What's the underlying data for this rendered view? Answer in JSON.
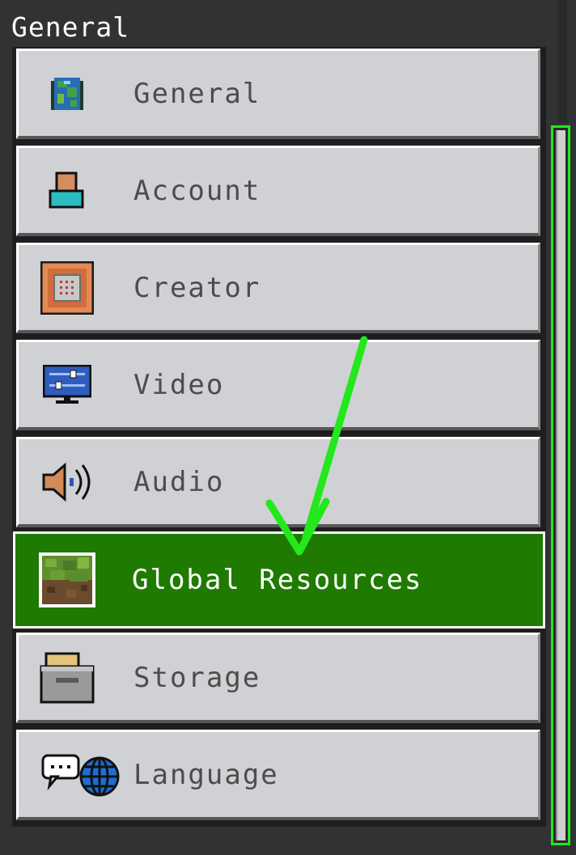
{
  "section": {
    "title": "General"
  },
  "menu": {
    "items": [
      {
        "label": "General"
      },
      {
        "label": "Account"
      },
      {
        "label": "Creator"
      },
      {
        "label": "Video"
      },
      {
        "label": "Audio"
      },
      {
        "label": "Global Resources",
        "selected": true
      },
      {
        "label": "Storage"
      },
      {
        "label": "Language"
      }
    ]
  },
  "colors": {
    "background": "#313233",
    "item_bg": "#d0d1d4",
    "selected_bg": "#1f7a02",
    "annotation_arrow": "#22e81c",
    "scrollbar_highlight": "#21e821"
  }
}
